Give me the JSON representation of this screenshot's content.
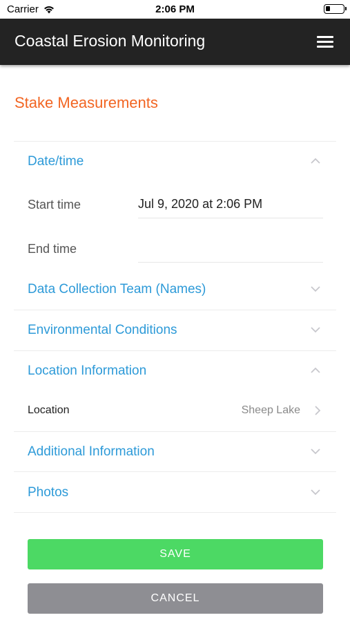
{
  "status_bar": {
    "carrier": "Carrier",
    "time": "2:06 PM",
    "battery_level": 0.25
  },
  "app_bar": {
    "title": "Coastal Erosion Monitoring",
    "menu_icon": "hamburger-menu-icon"
  },
  "page": {
    "title": "Stake Measurements"
  },
  "sections": {
    "datetime": {
      "label": "Date/time",
      "expanded": true,
      "start_label": "Start time",
      "start_value": "Jul 9, 2020 at 2:06 PM",
      "end_label": "End time",
      "end_value": ""
    },
    "team": {
      "label": "Data Collection Team (Names)",
      "expanded": false
    },
    "environment": {
      "label": "Environmental Conditions",
      "expanded": false
    },
    "location": {
      "label": "Location Information",
      "expanded": true,
      "location_label": "Location",
      "location_value": "Sheep Lake"
    },
    "additional": {
      "label": "Additional Information",
      "expanded": false
    },
    "photos": {
      "label": "Photos",
      "expanded": false
    }
  },
  "buttons": {
    "save": "SAVE",
    "cancel": "CANCEL"
  },
  "colors": {
    "accent_orange": "#f26522",
    "section_blue": "#2d9ad8",
    "save_green": "#4cd964",
    "cancel_gray": "#8e8e93",
    "app_bar": "#232323"
  }
}
